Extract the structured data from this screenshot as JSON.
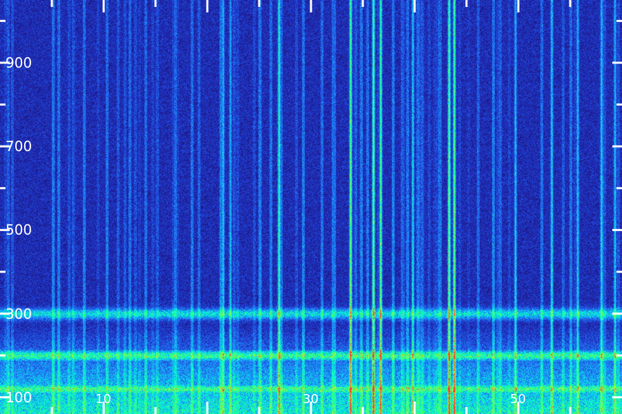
{
  "chart_data": {
    "type": "heatmap",
    "colormap": [
      "#1a0a55",
      "#2030c8",
      "#1e90ff",
      "#00ffd8",
      "#40ff60",
      "#c0ff40",
      "#ff3030"
    ],
    "background": "#1f0b57",
    "y_ticks": [
      {
        "value": 900,
        "label": "900"
      },
      {
        "value": 700,
        "label": "700"
      },
      {
        "value": 500,
        "label": "500"
      },
      {
        "value": 300,
        "label": "300"
      },
      {
        "value": 100,
        "label": "100"
      }
    ],
    "x_ticks": [
      {
        "value": 10,
        "label": "10"
      },
      {
        "value": 30,
        "label": "30"
      },
      {
        "value": 50,
        "label": "50"
      }
    ],
    "xlim": [
      0,
      60
    ],
    "ylim": [
      60,
      1050
    ],
    "vertical_lines": [
      {
        "x": 21.5,
        "intensity": 0.45
      },
      {
        "x": 22.2,
        "intensity": 0.4
      },
      {
        "x": 26.9,
        "intensity": 0.7
      },
      {
        "x": 33.8,
        "intensity": 0.85
      },
      {
        "x": 36.0,
        "intensity": 0.9
      },
      {
        "x": 36.7,
        "intensity": 0.8
      },
      {
        "x": 39.8,
        "intensity": 0.5
      },
      {
        "x": 43.3,
        "intensity": 0.9
      },
      {
        "x": 43.8,
        "intensity": 0.85
      },
      {
        "x": 49.7,
        "intensity": 0.45
      },
      {
        "x": 53.2,
        "intensity": 0.5
      },
      {
        "x": 55.7,
        "intensity": 0.45
      },
      {
        "x": 58.0,
        "intensity": 0.5
      },
      {
        "x": 59.3,
        "intensity": 0.45
      }
    ],
    "horizontal_bands": [
      {
        "y": 300,
        "intensity": 0.5
      },
      {
        "y": 200,
        "intensity": 0.7
      },
      {
        "y": 120,
        "intensity": 0.75
      }
    ]
  }
}
